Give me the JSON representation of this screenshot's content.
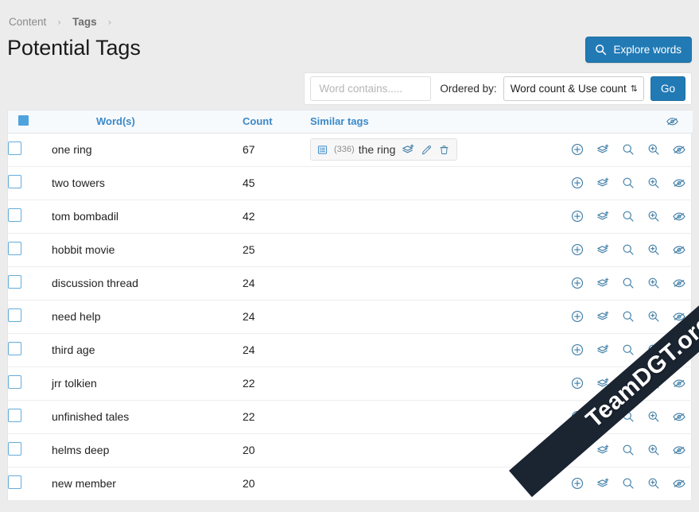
{
  "breadcrumb": {
    "items": [
      {
        "label": "Content",
        "strong": false
      },
      {
        "label": "Tags",
        "strong": true
      }
    ],
    "separator": "›"
  },
  "header": {
    "title": "Potential Tags",
    "explore_button": {
      "label": "Explore words",
      "icon": "search-icon",
      "color": "#227ab5"
    }
  },
  "filter": {
    "word_input_placeholder": "Word contains.....",
    "word_input_value": "",
    "ordered_by_label": "Ordered by:",
    "order_selected": "Word count & Use count",
    "order_caret": "⇅",
    "go_label": "Go"
  },
  "table": {
    "headers": {
      "check": "",
      "word": "Word(s)",
      "count": "Count",
      "similar": "Similar tags",
      "actions": ""
    },
    "header_actions": [
      "eye-slash-icon"
    ],
    "row_actions": [
      "plus-circle-icon",
      "merge-layers-icon",
      "search-icon",
      "search-plus-icon",
      "eye-slash-icon"
    ],
    "rows": [
      {
        "word": "one ring",
        "count": "67",
        "similar": [
          {
            "count": "(336)",
            "name": "the ring",
            "icon": "list-icon",
            "actions": [
              "merge-layers-icon",
              "pencil-icon",
              "trash-icon"
            ]
          }
        ]
      },
      {
        "word": "two towers",
        "count": "45",
        "similar": []
      },
      {
        "word": "tom bombadil",
        "count": "42",
        "similar": []
      },
      {
        "word": "hobbit movie",
        "count": "25",
        "similar": []
      },
      {
        "word": "discussion thread",
        "count": "24",
        "similar": []
      },
      {
        "word": "need help",
        "count": "24",
        "similar": []
      },
      {
        "word": "third age",
        "count": "24",
        "similar": []
      },
      {
        "word": "jrr tolkien",
        "count": "22",
        "similar": []
      },
      {
        "word": "unfinished tales",
        "count": "22",
        "similar": []
      },
      {
        "word": "helms deep",
        "count": "20",
        "similar": []
      },
      {
        "word": "new member",
        "count": "20",
        "similar": []
      }
    ]
  },
  "watermark": {
    "text": "TeamDGT.org",
    "color": "#1b2431"
  },
  "colors": {
    "accent": "#227ab5",
    "header_text": "#3a89c9",
    "icon": "#3d7ca6",
    "page_bg": "#ececec"
  }
}
